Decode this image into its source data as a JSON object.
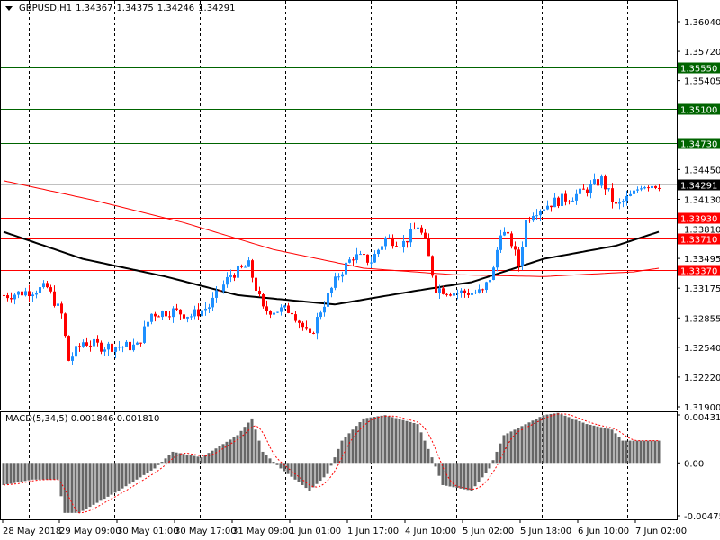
{
  "header": {
    "symbol": "GBPUSD,H1",
    "open": "1.34367",
    "high": "1.34375",
    "low": "1.34246",
    "close": "1.34291"
  },
  "macd_label": {
    "name": "MACD(5,34,5)",
    "main": "0.001846",
    "signal": "0.001810"
  },
  "chart_data": {
    "type": "candlestick",
    "title": "GBPUSD,H1",
    "price_ylim": [
      1.319,
      1.3604
    ],
    "price_ticks": [
      "1.36040",
      "1.35720",
      "1.35405",
      "1.34450",
      "1.34130",
      "1.33810",
      "1.33495",
      "1.33175",
      "1.32855",
      "1.32540",
      "1.32220",
      "1.31900"
    ],
    "bars": 183,
    "close_path": [
      [
        1,
        1.331
      ],
      [
        12,
        1.3318
      ],
      [
        16,
        1.3289
      ],
      [
        18,
        1.324
      ],
      [
        22,
        1.326
      ],
      [
        27,
        1.3255
      ],
      [
        37,
        1.3255
      ],
      [
        41,
        1.329
      ],
      [
        47,
        1.3293
      ],
      [
        52,
        1.3288
      ],
      [
        57,
        1.3298
      ],
      [
        63,
        1.3332
      ],
      [
        68,
        1.3342
      ],
      [
        72,
        1.3294
      ],
      [
        80,
        1.3294
      ],
      [
        85,
        1.3264
      ],
      [
        88,
        1.3294
      ],
      [
        93,
        1.3332
      ],
      [
        97,
        1.3352
      ],
      [
        102,
        1.3347
      ],
      [
        106,
        1.3371
      ],
      [
        111,
        1.3366
      ],
      [
        115,
        1.3385
      ],
      [
        117,
        1.3366
      ],
      [
        120,
        1.3318
      ],
      [
        125,
        1.3313
      ],
      [
        133,
        1.3313
      ],
      [
        136,
        1.3337
      ],
      [
        138,
        1.338
      ],
      [
        141,
        1.3366
      ],
      [
        143,
        1.3342
      ],
      [
        145,
        1.339
      ],
      [
        147,
        1.34
      ],
      [
        152,
        1.3409
      ],
      [
        160,
        1.3419
      ],
      [
        166,
        1.3434
      ],
      [
        170,
        1.3405
      ],
      [
        175,
        1.3419
      ],
      [
        177,
        1.3429
      ],
      [
        182,
        1.3429
      ]
    ],
    "ma_black": [
      [
        0,
        1.3378
      ],
      [
        22,
        1.3349
      ],
      [
        45,
        1.333
      ],
      [
        65,
        1.331
      ],
      [
        92,
        1.33
      ],
      [
        115,
        1.3315
      ],
      [
        130,
        1.3324
      ],
      [
        150,
        1.3349
      ],
      [
        170,
        1.3363
      ],
      [
        182,
        1.3378
      ]
    ],
    "ma_red": [
      [
        0,
        1.3433
      ],
      [
        25,
        1.3412
      ],
      [
        50,
        1.3388
      ],
      [
        75,
        1.3359
      ],
      [
        100,
        1.3339
      ],
      [
        125,
        1.3332
      ],
      [
        150,
        1.333
      ],
      [
        175,
        1.3335
      ],
      [
        182,
        1.3339
      ]
    ],
    "levels": [
      {
        "price": "1.35550",
        "color": "#006400"
      },
      {
        "price": "1.35100",
        "color": "#006400"
      },
      {
        "price": "1.34730",
        "color": "#006400"
      },
      {
        "price": "1.33930",
        "color": "#ff0000"
      },
      {
        "price": "1.33710",
        "color": "#ff0000"
      },
      {
        "price": "1.33370",
        "color": "#ff0000"
      }
    ],
    "current_price": "1.34291",
    "macd_ylim": [
      -0.004757,
      0.004317
    ],
    "macd_ticks": [
      "0.004317",
      "0.00",
      "-0.004757"
    ],
    "macd_path": [
      [
        0,
        -0.002
      ],
      [
        8,
        -0.0015
      ],
      [
        15,
        -0.0015
      ],
      [
        17,
        -0.0045
      ],
      [
        21,
        -0.0045
      ],
      [
        32,
        -0.0025
      ],
      [
        42,
        -0.0005
      ],
      [
        47,
        0.001
      ],
      [
        55,
        0.0005
      ],
      [
        65,
        0.0025
      ],
      [
        69,
        0.004
      ],
      [
        72,
        0.001
      ],
      [
        77,
        -0.0005
      ],
      [
        85,
        -0.0025
      ],
      [
        90,
        -0.001
      ],
      [
        94,
        0.002
      ],
      [
        100,
        0.004
      ],
      [
        106,
        0.0043
      ],
      [
        115,
        0.0035
      ],
      [
        119,
        0.0005
      ],
      [
        122,
        -0.002
      ],
      [
        130,
        -0.0025
      ],
      [
        135,
        -0.0005
      ],
      [
        139,
        0.0025
      ],
      [
        150,
        0.0043
      ],
      [
        154,
        0.0045
      ],
      [
        162,
        0.0035
      ],
      [
        169,
        0.003
      ],
      [
        172,
        0.002
      ],
      [
        182,
        0.002
      ]
    ],
    "x_labels": [
      "28 May 2018",
      "29 May 09:00",
      "30 May 01:00",
      "30 May 17:00",
      "31 May 09:00",
      "1 Jun 01:00",
      "1 Jun 17:00",
      "4 Jun 10:00",
      "5 Jun 02:00",
      "5 Jun 18:00",
      "6 Jun 10:00",
      "7 Jun 02:00"
    ],
    "colors": {
      "bull": "#1e90ff",
      "bear": "#ff0000",
      "ma_black": "#000000",
      "ma_red": "#ff0000",
      "hist": "#666666",
      "signal": "#ff0000"
    }
  }
}
